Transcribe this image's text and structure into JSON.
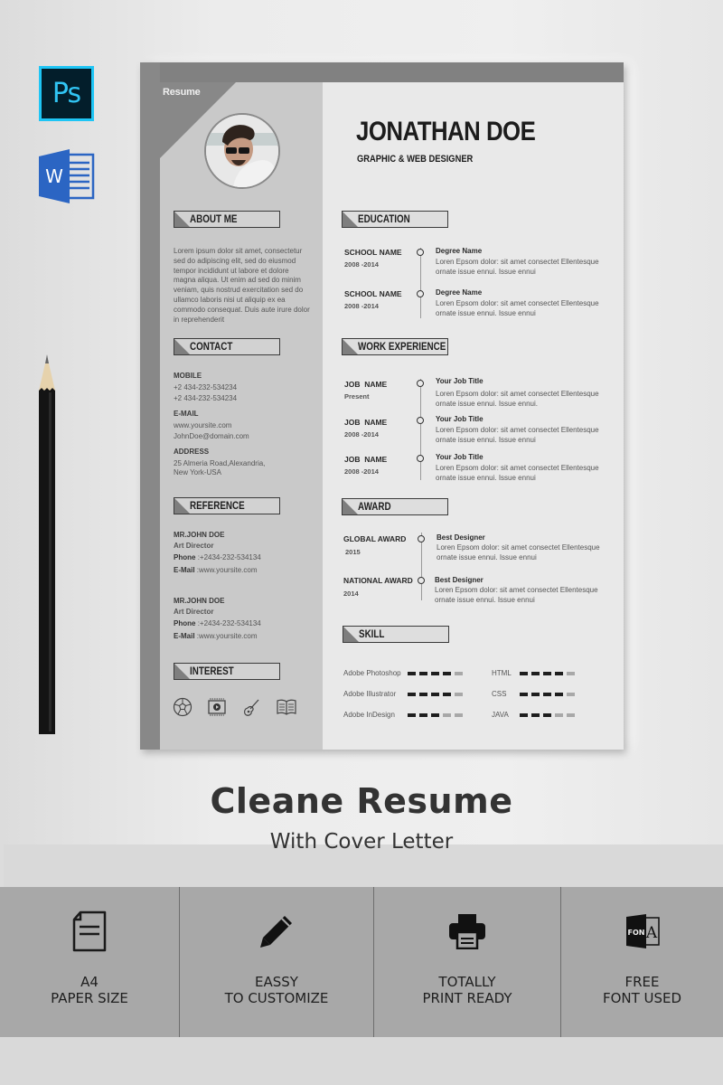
{
  "app_icons": [
    {
      "name": "photoshop",
      "label": "Ps",
      "color": "#31c5f4",
      "bg": "#031e2b"
    },
    {
      "name": "word",
      "label": "W",
      "color": "#2b65c3"
    }
  ],
  "resume": {
    "tag": "Resume",
    "name": "JONATHAN DOE",
    "role": "GRAPHIC & WEB DESIGNER",
    "sidebar": {
      "about": {
        "title": "ABOUT ME",
        "text": "Lorem ipsum dolor sit amet, consectetur sed do adipiscing elit, sed do eiusmod tempor incididunt ut labore et dolore magna aliqua. Ut enim ad sed do minim veniam, quis nostrud exercitation sed do ullamco laboris nisi ut aliquip ex ea commodo consequat. Duis aute irure dolor in reprehenderit"
      },
      "contact": {
        "title": "CONTACT",
        "mobile_label": "MOBILE",
        "mobile": [
          "+2 434-232-534234",
          "+2 434-232-534234"
        ],
        "email_label": "E-MAIL",
        "email": [
          "www.yoursite.com",
          "JohnDoe@domain.com"
        ],
        "address_label": "ADDRESS",
        "address": [
          "25 Almeria Road,Alexandria,",
          "New York-USA"
        ]
      },
      "reference": {
        "title": "REFERENCE",
        "people": [
          {
            "name": "MR.JOHN DOE",
            "title": "Art Director",
            "phone_label": "Phone",
            "phone": ":+2434-232-534134",
            "email_label": "E-Mail",
            "email": ":www.yoursite.com"
          },
          {
            "name": "MR.JOHN DOE",
            "title": "Art Director",
            "phone_label": "Phone",
            "phone": ":+2434-232-534134",
            "email_label": "E-Mail",
            "email": ":www.yoursite.com"
          }
        ]
      },
      "interest": {
        "title": "INTEREST",
        "icons": [
          "football-icon",
          "video-icon",
          "guitar-icon",
          "book-icon"
        ]
      }
    },
    "education": {
      "title": "EDUCATION",
      "entries": [
        {
          "left": "SCHOOL NAME",
          "sub": "2008 -2014",
          "title": "Degree Name",
          "desc": "Loren Epsom dolor: sit amet consectet Ellentesque ornate issue ennui. Issue ennui"
        },
        {
          "left": "SCHOOL NAME",
          "sub": "2008 -2014",
          "title": "Degree Name",
          "desc": "Loren Epsom dolor: sit amet consectet Ellentesque ornate issue ennui. Issue ennui"
        }
      ]
    },
    "work": {
      "title": "WORK EXPERIENCE",
      "entries": [
        {
          "left": "JOB  NAME",
          "sub": "Present",
          "title": "Your Job Title",
          "desc": "Loren Epsom dolor: sit amet consectet Ellentesque ornate issue ennui. Issue ennui."
        },
        {
          "left": "JOB  NAME",
          "sub": "2008 -2014",
          "title": "Your Job Title",
          "desc": "Loren Epsom dolor: sit amet consectet Ellentesque ornate issue ennui. Issue ennui"
        },
        {
          "left": "JOB  NAME",
          "sub": "2008 -2014",
          "title": "Your Job Title",
          "desc": "Loren Epsom dolor: sit amet consectet Ellentesque ornate issue ennui. Issue ennui"
        }
      ]
    },
    "award": {
      "title": "AWARD",
      "entries": [
        {
          "left": "GLOBAL AWARD",
          "sub": "2015",
          "title": "Best Designer",
          "desc": "Loren Epsom dolor: sit amet consectet Ellentesque ornate issue ennui. Issue ennui"
        },
        {
          "left": "NATIONAL AWARD",
          "sub": "2014",
          "title": "Best Designer",
          "desc": "Loren Epsom dolor: sit amet consectet Ellentesque ornate issue ennui. Issue ennui"
        }
      ]
    },
    "skill": {
      "title": "SKILL",
      "max": 5,
      "left": [
        {
          "name": "Adobe Photoshop",
          "level": 4
        },
        {
          "name": "Adobe Illustrator",
          "level": 4
        },
        {
          "name": "Adobe InDesign",
          "level": 3
        }
      ],
      "right": [
        {
          "name": "HTML",
          "level": 4
        },
        {
          "name": "CSS",
          "level": 4
        },
        {
          "name": "JAVA",
          "level": 3
        }
      ]
    }
  },
  "product": {
    "title": "Cleane Resume",
    "subtitle": "With Cover Letter"
  },
  "features": [
    {
      "icon": "document-icon",
      "line1": "A4",
      "line2": "PAPER SIZE"
    },
    {
      "icon": "pencil-icon",
      "line1": "EASSY",
      "line2": "TO CUSTOMIZE"
    },
    {
      "icon": "printer-icon",
      "line1": "TOTALLY",
      "line2": "PRINT READY"
    },
    {
      "icon": "font-icon",
      "line1": "FREE",
      "line2": "FONT USED",
      "icon_text_a": "FON",
      "icon_text_b": "A"
    }
  ]
}
